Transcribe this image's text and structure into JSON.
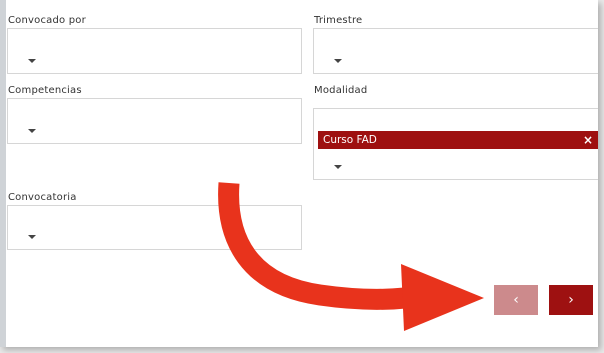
{
  "filters": {
    "convocado_por": {
      "label": "Convocado por",
      "value": ""
    },
    "trimestre": {
      "label": "Trimestre",
      "value": ""
    },
    "competencias": {
      "label": "Competencias",
      "value": ""
    },
    "modalidad": {
      "label": "Modalidad",
      "selected_tags": [
        "Curso FAD"
      ],
      "tag_remove_glyph": "×"
    },
    "convocatoria": {
      "label": "Convocatoria",
      "value": ""
    }
  },
  "pagination": {
    "prev_glyph": "‹",
    "next_glyph": "›",
    "prev_enabled": false,
    "next_enabled": true
  },
  "annotation": {
    "type": "curved-arrow",
    "color": "#e8331c",
    "points_to": "pagination"
  },
  "colors": {
    "accent": "#9e1010",
    "disabled_button": "#cc8a8c",
    "field_border": "#d6d6d6",
    "annotation_arrow": "#e8331c"
  }
}
